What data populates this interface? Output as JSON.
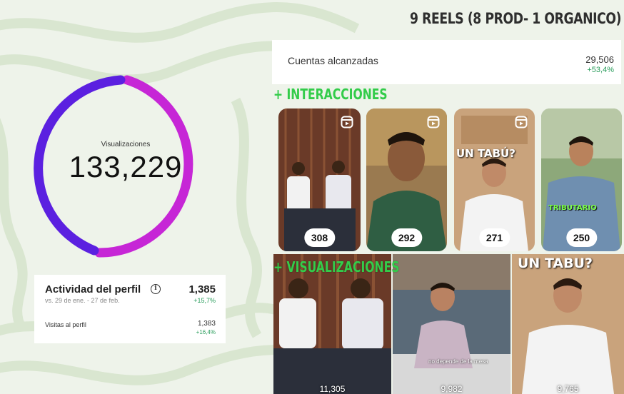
{
  "header": {
    "title": "9 REELS (8 PROD- 1 ORGANICO)"
  },
  "views_donut": {
    "caption": "Visualizaciones",
    "value": "133,229",
    "colors": {
      "primary": "#c626d6",
      "secondary": "#5b20e0"
    }
  },
  "profile_activity": {
    "title": "Actividad del perfil",
    "info_icon": "info-icon",
    "value": "1,385",
    "range": "vs. 29 de ene. - 27 de feb.",
    "delta": "+15,7%",
    "visits_label": "Visitas al perfil",
    "visits_value": "1,383",
    "visits_delta": "+16,4%"
  },
  "accounts_reached": {
    "label": "Cuentas alcanzadas",
    "value": "29,506",
    "delta": "+53,4%"
  },
  "sections": {
    "interactions": "+ INTERACCIONES",
    "views": "+ VISUALIZACIONES"
  },
  "interaction_reels": [
    {
      "count": "308",
      "icon": "reels-icon"
    },
    {
      "count": "292",
      "icon": "reels-icon"
    },
    {
      "count": "271",
      "icon": "reels-icon",
      "overlay": "UN TABÚ?"
    },
    {
      "count": "250",
      "overlay": "TRIBUTARIO"
    }
  ],
  "view_reels": [
    {
      "count": "11,305"
    },
    {
      "count": "9,982",
      "caption": "no depende de la mesa"
    },
    {
      "count": "9,765",
      "overlay": "UN TABU?"
    }
  ],
  "accent_green": "#33cc4a",
  "delta_green": "#2a9d5c"
}
